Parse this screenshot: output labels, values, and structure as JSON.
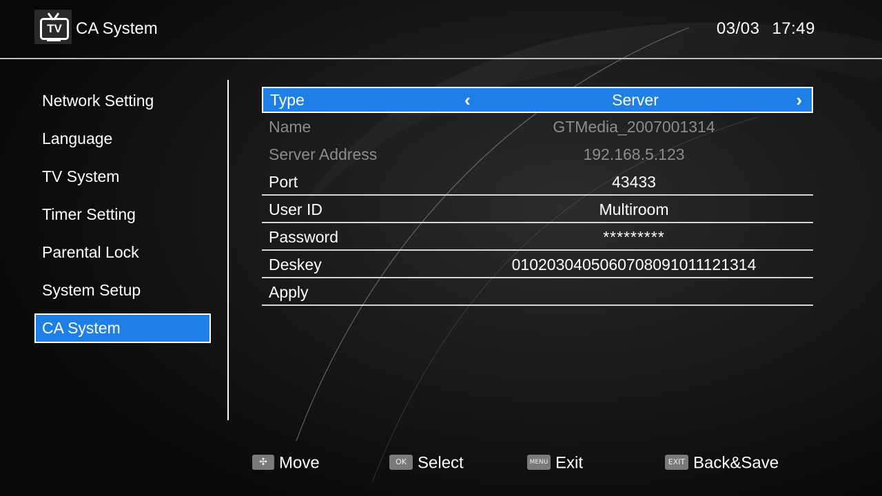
{
  "header": {
    "title": "CA System",
    "logo_icon": "tv-icon",
    "logo_text": "TV",
    "date": "03/03",
    "time": "17:49"
  },
  "sidebar": {
    "items": [
      {
        "label": "Network Setting"
      },
      {
        "label": "Language"
      },
      {
        "label": "TV System"
      },
      {
        "label": "Timer Setting"
      },
      {
        "label": "Parental Lock"
      },
      {
        "label": "System Setup"
      },
      {
        "label": "CA System",
        "active": true
      }
    ]
  },
  "form": {
    "type": {
      "label": "Type",
      "value": "Server",
      "left_arrow": "‹",
      "right_arrow": "›"
    },
    "name": {
      "label": "Name",
      "value": "GTMedia_2007001314"
    },
    "server_address": {
      "label": "Server Address",
      "value": "192.168.5.123"
    },
    "port": {
      "label": "Port",
      "value": "43433"
    },
    "user_id": {
      "label": "User ID",
      "value": "Multiroom"
    },
    "password": {
      "label": "Password",
      "value": "*********"
    },
    "deskey": {
      "label": "Deskey",
      "value": "0102030405060708091011121314"
    },
    "apply": {
      "label": "Apply"
    }
  },
  "footer": {
    "move": {
      "key": "✣",
      "label": "Move"
    },
    "select": {
      "key": "OK",
      "label": "Select"
    },
    "exit": {
      "key": "MENU",
      "label": "Exit"
    },
    "back_save": {
      "key": "EXIT",
      "label": "Back&Save"
    }
  },
  "colors": {
    "highlight": "#1e7fe6",
    "disabled_text": "#8c8c8c",
    "background": "#0d0d0d"
  }
}
